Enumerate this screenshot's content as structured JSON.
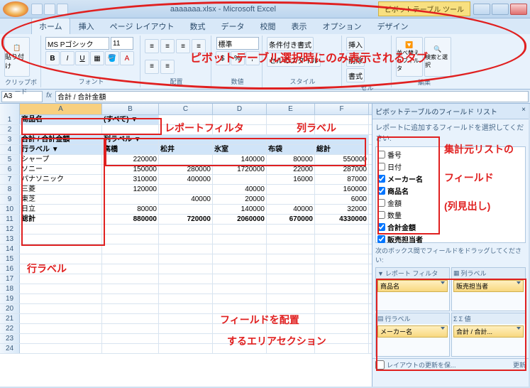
{
  "title": "aaaaaaa.xlsx - Microsoft Excel",
  "context_tab": "ピボットテーブル ツール",
  "tabs": [
    "ホーム",
    "挿入",
    "ページ レイアウト",
    "数式",
    "データ",
    "校閲",
    "表示",
    "オプション",
    "デザイン"
  ],
  "ribbon": {
    "clipboard": "クリップボード",
    "paste": "貼り付け",
    "font_group": "フォント",
    "font_name": "MS Pゴシック",
    "font_size": "11",
    "align_group": "配置",
    "number_group": "数値",
    "number_fmt": "標準",
    "styles_group": "スタイル",
    "cond_fmt": "条件付き書式",
    "cell_style": "セルのスタイル",
    "cells_group": "セル",
    "insert": "挿入",
    "delete": "削除",
    "format": "書式",
    "edit_group": "編集",
    "sort_filter": "並べ替えとフィルタ",
    "find_select": "検索と選択"
  },
  "namebox": "A3",
  "formula": "合計 / 合計金額",
  "cols": [
    "A",
    "B",
    "C",
    "D",
    "E",
    "F"
  ],
  "pivot": {
    "filter_field": "商品名",
    "filter_value": "(すべて)",
    "data_field": "合計 / 合計金額",
    "col_field": "列ラベル",
    "row_field": "行ラベル",
    "col_labels": [
      "高橋",
      "松井",
      "氷室",
      "布袋",
      "総計"
    ],
    "rows": [
      {
        "label": "シャープ",
        "vals": [
          "220000",
          "",
          "140000",
          "80000",
          "550000"
        ]
      },
      {
        "label": "ソニー",
        "vals": [
          "150000",
          "280000",
          "1720000",
          "22000",
          "287000"
        ]
      },
      {
        "label": "パナソニック",
        "vals": [
          "310000",
          "400000",
          "",
          "16000",
          "87000"
        ]
      },
      {
        "label": "三菱",
        "vals": [
          "120000",
          "",
          "40000",
          "",
          "160000"
        ]
      },
      {
        "label": "東芝",
        "vals": [
          "",
          "40000",
          "20000",
          "",
          "6000"
        ]
      },
      {
        "label": "日立",
        "vals": [
          "80000",
          "",
          "140000",
          "40000",
          "32000"
        ]
      }
    ],
    "totals": {
      "label": "総計",
      "vals": [
        "880000",
        "720000",
        "2060000",
        "670000",
        "4330000"
      ]
    }
  },
  "taskpane": {
    "title": "ピボットテーブルのフィールド リスト",
    "hint": "レポートに追加するフィールドを選択してください:",
    "fields": [
      {
        "label": "番号",
        "checked": false
      },
      {
        "label": "日付",
        "checked": false
      },
      {
        "label": "メーカー名",
        "checked": true
      },
      {
        "label": "商品名",
        "checked": true
      },
      {
        "label": "金額",
        "checked": false
      },
      {
        "label": "数量",
        "checked": false
      },
      {
        "label": "合計金額",
        "checked": true
      },
      {
        "label": "販売担当者",
        "checked": true
      }
    ],
    "areas_hint": "次のボックス間でフィールドをドラッグしてください:",
    "area_filter": "レポート フィルタ",
    "area_col": "列ラベル",
    "area_row": "行ラベル",
    "area_val": "Σ 値",
    "filter_items": [
      "商品名"
    ],
    "col_items": [
      "販売担当者"
    ],
    "row_items": [
      "メーカー名"
    ],
    "val_items": [
      "合計 / 合計..."
    ],
    "defer": "レイアウトの更新を保...",
    "update": "更新"
  },
  "anno": {
    "ribbon_text": "ピボットテーブル選択時にのみ表示されるタブ",
    "report_filter": "レポートフィルタ",
    "col_label": "列ラベル",
    "row_label": "行ラベル",
    "field_list1": "集計元リストの",
    "field_list2": "フィールド",
    "field_list3": "(列見出し)",
    "area1": "フィールドを配置",
    "area2": "するエリアセクション"
  },
  "colors": {
    "accent": "#3a5a7a",
    "anno": "#e02020"
  }
}
